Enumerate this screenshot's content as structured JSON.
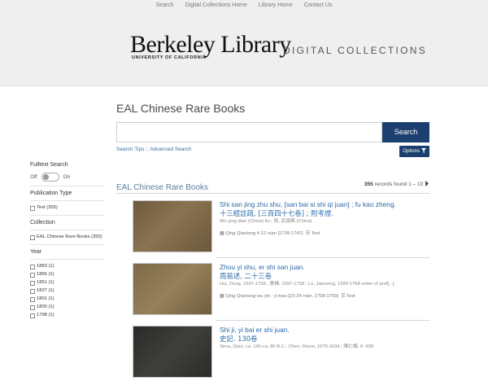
{
  "topnav": [
    "Search",
    "Digital Collections Home",
    "Library Home",
    "Contact Us"
  ],
  "logo": {
    "main": "Berkeley Library",
    "sub": "UNIVERSITY OF CALIFORNIA",
    "digital": "DIGITAL COLLECTIONS"
  },
  "collection_title": "EAL Chinese Rare Books",
  "search": {
    "placeholder": "",
    "button": "Search",
    "tips": "Search Tips",
    "advanced": "Advanced Search",
    "options": "Options"
  },
  "sidebar": {
    "fulltext": {
      "heading": "Fulltext Search",
      "off": "Off",
      "on": "On"
    },
    "pubtype": {
      "heading": "Publication Type",
      "items": [
        "Text (355)"
      ]
    },
    "collection": {
      "heading": "Collection",
      "items": [
        "EAL Chinese Rare Books (355)"
      ]
    },
    "year": {
      "heading": "Year",
      "items": [
        "1883 (1)",
        "1856 (1)",
        "1851 (1)",
        "1827 (1)",
        "1801 (1)",
        "1800 (1)",
        "1798 (1)"
      ]
    }
  },
  "results": {
    "title": "EAL Chinese Rare Books",
    "count_num": "355",
    "count_rest": "records found 1 – 10",
    "items": [
      {
        "title": "Shi san jing zhu shu, [san bai si shi qi juan] ; fu kao zheng.",
        "cjk": "十三經註疏, [三百四十七卷] ; 附考證.",
        "meta": "Wu ying dian (China) ko.; 刻, 武英殿 (China)",
        "date": "Qing Qianlong 4-12 nian [1739-1747]",
        "type": "Text"
      },
      {
        "title": "Zhou yi shu, er shi san juan.",
        "cjk": "周易述, 二十三卷",
        "meta": "Hui, Dong, 1697-1758.; 惠棟, 1697-1758.; Lu, Jianzeng, 1690-1768 writer of prof[...]",
        "date": "Qing Qianlong wu yin - ji mao [23-24 nian, 1758-1759]",
        "type": "Text"
      },
      {
        "title": "Shi ji, yi bai er shi juan.",
        "cjk": "史記. 130卷",
        "meta": "Sima, Qian, ca. 145-ca. 86 B.C.; Chen, Renxi, 1579-1634.; 陳仁錫, fl. 438.",
        "date": "",
        "type": ""
      }
    ]
  }
}
